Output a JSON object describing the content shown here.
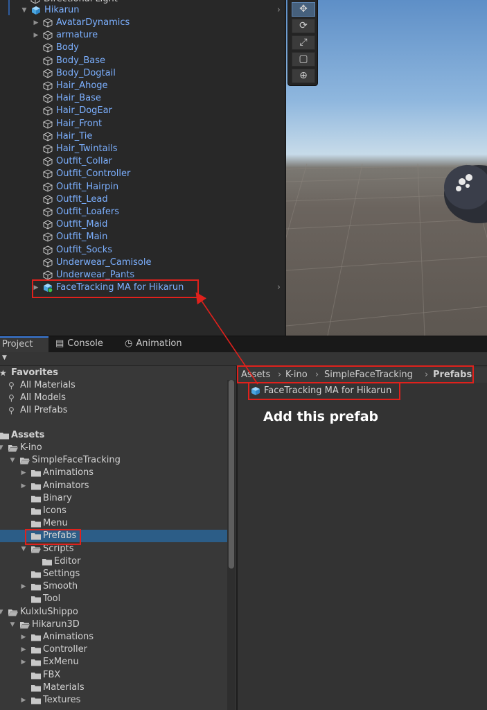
{
  "hierarchy": {
    "partial_top": "Directional Light",
    "root": "Hikarun",
    "children": [
      {
        "label": "AvatarDynamics",
        "expandable": true
      },
      {
        "label": "armature",
        "expandable": true
      },
      {
        "label": "Body",
        "expandable": false
      },
      {
        "label": "Body_Base",
        "expandable": false
      },
      {
        "label": "Body_Dogtail",
        "expandable": false
      },
      {
        "label": "Hair_Ahoge",
        "expandable": false
      },
      {
        "label": "Hair_Base",
        "expandable": false
      },
      {
        "label": "Hair_DogEar",
        "expandable": false
      },
      {
        "label": "Hair_Front",
        "expandable": false
      },
      {
        "label": "Hair_Tie",
        "expandable": false
      },
      {
        "label": "Hair_Twintails",
        "expandable": false
      },
      {
        "label": "Outfit_Collar",
        "expandable": false
      },
      {
        "label": "Outfit_Controller",
        "expandable": false
      },
      {
        "label": "Outfit_Hairpin",
        "expandable": false
      },
      {
        "label": "Outfit_Lead",
        "expandable": false
      },
      {
        "label": "Outfit_Loafers",
        "expandable": false
      },
      {
        "label": "Outfit_Maid",
        "expandable": false
      },
      {
        "label": "Outfit_Main",
        "expandable": false
      },
      {
        "label": "Outfit_Socks",
        "expandable": false
      },
      {
        "label": "Underwear_Camisole",
        "expandable": false
      },
      {
        "label": "Underwear_Pants",
        "expandable": false
      }
    ],
    "added_prefab": "FaceTracking MA for Hikarun",
    "more_glyph": "›"
  },
  "scene_tools": [
    "move",
    "rotate",
    "scale",
    "rect",
    "transform"
  ],
  "tabs": [
    {
      "label": "Project",
      "icon": "",
      "active": true
    },
    {
      "label": "Console",
      "icon": "console-icon",
      "active": false
    },
    {
      "label": "Animation",
      "icon": "animation-clock-icon",
      "active": false
    }
  ],
  "project_tree": {
    "favorites_label": "Favorites",
    "favorites": [
      "All Materials",
      "All Models",
      "All Prefabs"
    ],
    "assets_label": "Assets",
    "rows": [
      {
        "label": "K-ino",
        "depth": 0,
        "arrow": "open",
        "selected": false
      },
      {
        "label": "SimpleFaceTracking",
        "depth": 1,
        "arrow": "open",
        "selected": false
      },
      {
        "label": "Animations",
        "depth": 2,
        "arrow": "closed",
        "selected": false
      },
      {
        "label": "Animators",
        "depth": 2,
        "arrow": "closed",
        "selected": false
      },
      {
        "label": "Binary",
        "depth": 2,
        "arrow": "none",
        "selected": false
      },
      {
        "label": "Icons",
        "depth": 2,
        "arrow": "none",
        "selected": false
      },
      {
        "label": "Menu",
        "depth": 2,
        "arrow": "none",
        "selected": false
      },
      {
        "label": "Prefabs",
        "depth": 2,
        "arrow": "none",
        "selected": true
      },
      {
        "label": "Scripts",
        "depth": 2,
        "arrow": "open",
        "selected": false
      },
      {
        "label": "Editor",
        "depth": 3,
        "arrow": "none",
        "selected": false
      },
      {
        "label": "Settings",
        "depth": 2,
        "arrow": "none",
        "selected": false
      },
      {
        "label": "Smooth",
        "depth": 2,
        "arrow": "closed",
        "selected": false
      },
      {
        "label": "Tool",
        "depth": 2,
        "arrow": "none",
        "selected": false
      },
      {
        "label": "KulxluShippo",
        "depth": 0,
        "arrow": "open",
        "selected": false
      },
      {
        "label": "Hikarun3D",
        "depth": 1,
        "arrow": "open",
        "selected": false
      },
      {
        "label": "Animations",
        "depth": 2,
        "arrow": "closed",
        "selected": false
      },
      {
        "label": "Controller",
        "depth": 2,
        "arrow": "closed",
        "selected": false
      },
      {
        "label": "ExMenu",
        "depth": 2,
        "arrow": "closed",
        "selected": false
      },
      {
        "label": "FBX",
        "depth": 2,
        "arrow": "none",
        "selected": false
      },
      {
        "label": "Materials",
        "depth": 2,
        "arrow": "none",
        "selected": false
      },
      {
        "label": "Textures",
        "depth": 2,
        "arrow": "closed",
        "selected": false
      }
    ]
  },
  "breadcrumb": [
    "Assets",
    "K-ino",
    "SimpleFaceTracking",
    "Prefabs"
  ],
  "breadcrumb_sep": "›",
  "asset_item": "FaceTracking MA for Hikarun",
  "annotation": "Add this prefab",
  "colors": {
    "highlight": "#e0211c",
    "hierarchy_text": "#7cb0ff",
    "selection": "#2c5d87",
    "folder": "#c9c9c9",
    "cube_blue": "#5cb6f0"
  }
}
